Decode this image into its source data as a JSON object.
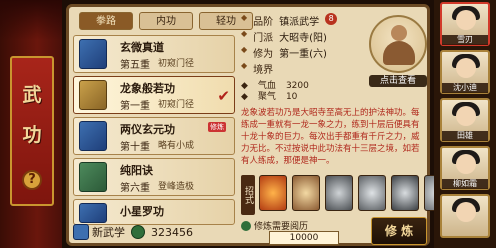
{
  "banner": {
    "title_top": "武",
    "title_bottom": "功",
    "help": "?"
  },
  "tabs": [
    {
      "label": "拳路",
      "active": true
    },
    {
      "label": "内功",
      "active": false
    },
    {
      "label": "轻功",
      "active": false
    }
  ],
  "skills": [
    {
      "name": "玄微真道",
      "level": "第五重",
      "stage": "初窥门径",
      "icon": "book-blue"
    },
    {
      "name": "龙象般若功",
      "level": "第一重",
      "stage": "初窥门径",
      "icon": "book-gold",
      "selected": true
    },
    {
      "name": "两仪玄元功",
      "level": "第十重",
      "stage": "略有小成",
      "icon": "book-blue",
      "badge": "修炼"
    },
    {
      "name": "纯阳诀",
      "level": "第六重",
      "stage": "登峰造极",
      "icon": "book-green"
    },
    {
      "name": "小星罗功",
      "level": "",
      "stage": "",
      "icon": "book-blue"
    }
  ],
  "bottom": {
    "new_skill_label": "新武学",
    "points": "323456"
  },
  "detail": {
    "grade_label": "品阶",
    "grade_value": "镇派武学",
    "grade_badge": "8",
    "faction_label": "门派",
    "faction_value": "大昭寺(阳)",
    "cultivation_label": "修为",
    "cultivation_value": "第一重(六)",
    "realm_label": "境界",
    "realm_value": "",
    "portrait_label": "点击查看",
    "stats": [
      {
        "label": "气血",
        "value": "3200"
      },
      {
        "label": "聚气",
        "value": "10"
      }
    ],
    "description": "龙象波若功乃是大昭寺至高无上的护法神功。每练成一重就有一龙一象之力，练到十层后便具有十龙十象的巨力。每次出手都重有千斤之力，威力无比。不过按说中此功法有十三层之境，如若有人练成，那便是神一。",
    "moves_label": "招式",
    "requirement_label": "修炼需要阅历",
    "requirement_value": "10000",
    "train_label": "修 炼"
  },
  "roster": [
    {
      "name": "雪刃"
    },
    {
      "name": "沈小迪"
    },
    {
      "name": "田雄"
    },
    {
      "name": "柳如霜"
    },
    {
      "name": ""
    }
  ],
  "colors": {
    "parchment": "#e9d9b6",
    "banner_red": "#a8251a",
    "gold_trim": "#c9962f"
  }
}
